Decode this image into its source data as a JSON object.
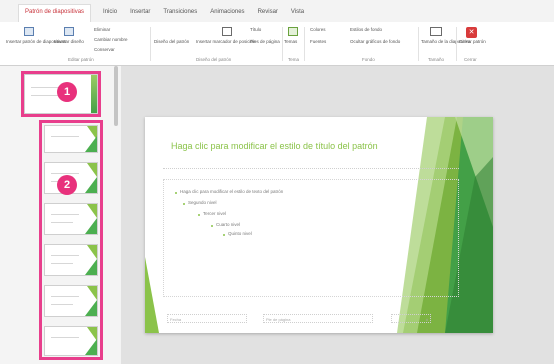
{
  "ribbon": {
    "tabs": [
      "Patrón de diapositivas",
      "Inicio",
      "Insertar",
      "Transiciones",
      "Animaciones",
      "Revisar",
      "Vista"
    ],
    "buttons": {
      "insert_master": "Insertar patrón de diapositivas",
      "insert_layout": "Insertar diseño",
      "delete": "Eliminar",
      "rename": "Cambiar nombre",
      "preserve": "Conservar",
      "master_layout": "Diseño del patrón",
      "insert_placeholder": "Insertar marcador de posición",
      "title": "Título",
      "footers": "Pies de página",
      "themes": "Temas",
      "colors": "Colores",
      "fonts": "Fuentes",
      "bg_styles": "Estilos de fondo",
      "hide_bg": "Ocultar gráficos de fondo",
      "slide_size": "Tamaño de la diapositiva",
      "close": "Cerrar patrón"
    },
    "groups": [
      "Editar patrón",
      "Diseño del patrón",
      "Tema",
      "Fondo",
      "Tamaño",
      "Cerrar"
    ]
  },
  "slide": {
    "title": "Haga clic para modificar el estilo de título del patrón",
    "levels": [
      "Haga clic para modificar el estilo de texto del patrón",
      "Segundo nivel",
      "Tercer nivel",
      "Cuarto nivel",
      "Quinto nivel"
    ],
    "footer_left": "Fecha",
    "footer_mid": "Pie de página",
    "footer_right": "#"
  },
  "badges": [
    "1",
    "2"
  ],
  "colors": {
    "accent": "#8bc34a",
    "accent_dark": "#43a047",
    "highlight": "#e83e8c",
    "close": "#d83b3b"
  }
}
